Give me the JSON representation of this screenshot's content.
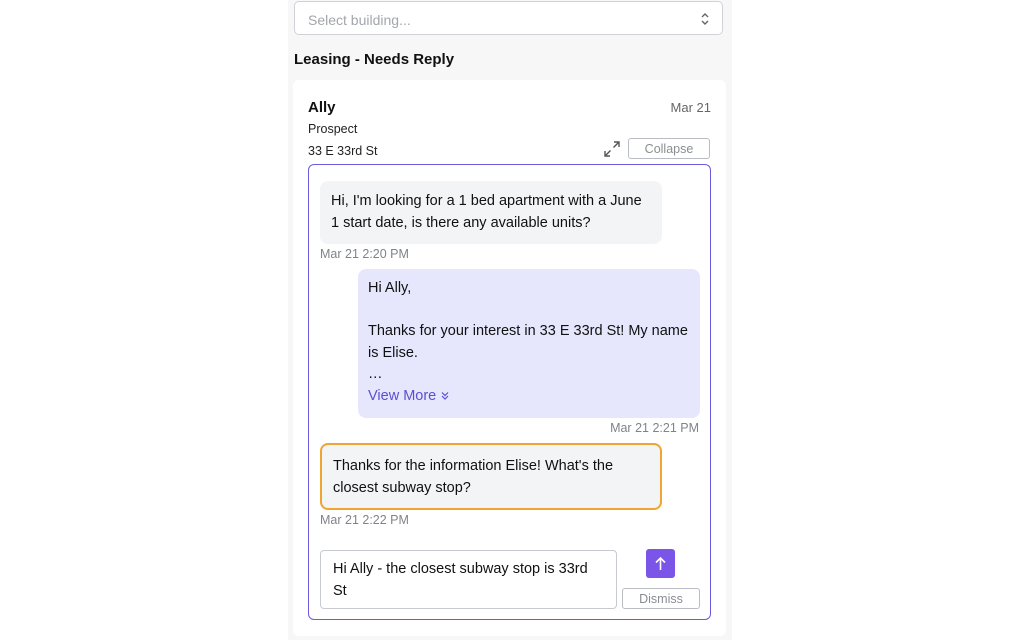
{
  "building_select": {
    "placeholder": "Select building...",
    "icon": "chevron-up-down-icon"
  },
  "section": {
    "title": "Leasing - Needs Reply"
  },
  "card": {
    "name": "Ally",
    "date": "Mar 21",
    "role": "Prospect",
    "address": "33 E 33rd St",
    "expand_icon": "expand-icon",
    "collapse_label": "Collapse"
  },
  "thread": {
    "messages": [
      {
        "text": "Hi, I'm looking for a 1 bed apartment with a June 1 start date, is there any available units?",
        "timestamp": "Mar 21 2:20 PM"
      },
      {
        "lines": [
          "Hi Ally,",
          "",
          "Thanks for your interest in 33 E 33rd St! My name is Elise.",
          "…"
        ],
        "view_more": "View More",
        "timestamp": "Mar 21 2:21 PM"
      },
      {
        "text": "Thanks for the information Elise! What's the closest subway stop?",
        "timestamp": "Mar 21 2:22 PM"
      }
    ],
    "reply_draft": "Hi Ally - the closest subway stop is 33rd St",
    "send_icon": "arrow-up-icon",
    "dismiss_label": "Dismiss"
  },
  "colors": {
    "accent": "#7b55e8",
    "thread_border": "#6b5be0",
    "outgoing_bubble": "#e6e7fd",
    "highlight_border": "#f0a431"
  }
}
